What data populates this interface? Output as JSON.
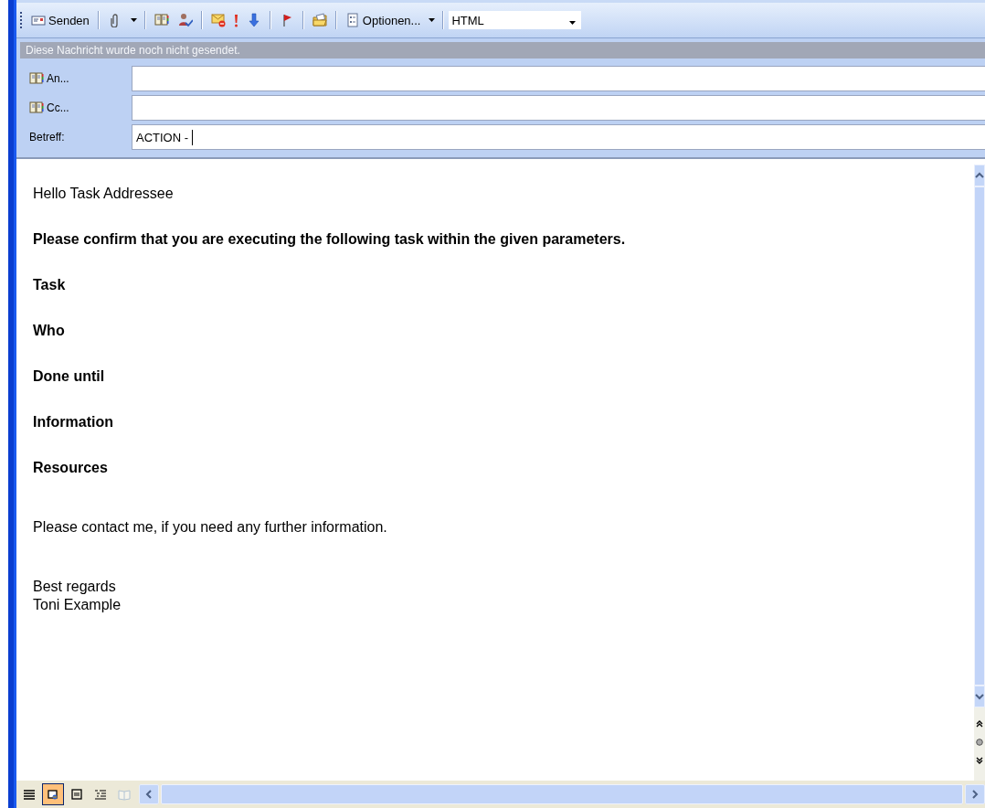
{
  "toolbar": {
    "items": [
      {
        "kind": "button",
        "label": "Senden"
      },
      {
        "kind": "separator"
      },
      {
        "kind": "button"
      },
      {
        "kind": "arrow"
      },
      {
        "kind": "separator"
      },
      {
        "kind": "button"
      },
      {
        "kind": "button"
      },
      {
        "kind": "separator"
      },
      {
        "kind": "button"
      },
      {
        "kind": "button"
      },
      {
        "kind": "button"
      },
      {
        "kind": "separator"
      },
      {
        "kind": "button"
      },
      {
        "kind": "separator"
      },
      {
        "kind": "button"
      },
      {
        "kind": "separator"
      },
      {
        "kind": "button",
        "label": "Optionen..."
      },
      {
        "kind": "arrow"
      },
      {
        "kind": "separator"
      },
      {
        "kind": "select",
        "value": "HTML"
      }
    ]
  },
  "infobar": "Diese Nachricht wurde noch nicht gesendet.",
  "fields": [
    {
      "kind": "address",
      "label": "An..."
    },
    {
      "kind": "address",
      "label": "Cc..."
    },
    {
      "kind": "plain",
      "label": "Betreff:",
      "value": "ACTION - "
    }
  ],
  "body": {
    "sections": [
      {
        "paragraphs": [
          {
            "kind": "plain",
            "lines": [
              "Hello Task Addressee"
            ]
          },
          {
            "kind": "bold",
            "lines": [
              "Please confirm that you are executing the following task within the given parameters."
            ]
          },
          {
            "kind": "bold",
            "lines": [
              "Task"
            ]
          },
          {
            "kind": "bold",
            "lines": [
              "Who"
            ]
          },
          {
            "kind": "bold",
            "lines": [
              "Done until"
            ]
          },
          {
            "kind": "bold",
            "lines": [
              "Information"
            ]
          },
          {
            "kind": "bold",
            "lines": [
              "Resources"
            ]
          }
        ]
      },
      {
        "paragraphs": [
          {
            "kind": "plain",
            "lines": [
              "Please contact me, if you need any further information."
            ]
          }
        ]
      },
      {
        "paragraphs": [
          {
            "kind": "plain",
            "lines": [
              "Best regards",
              "Toni Example"
            ]
          }
        ]
      }
    ]
  },
  "view_buttons": [
    {
      "selected": false,
      "disabled": false
    },
    {
      "selected": true,
      "disabled": false
    },
    {
      "selected": false,
      "disabled": false
    },
    {
      "selected": false,
      "disabled": false
    },
    {
      "selected": false,
      "disabled": true
    }
  ]
}
